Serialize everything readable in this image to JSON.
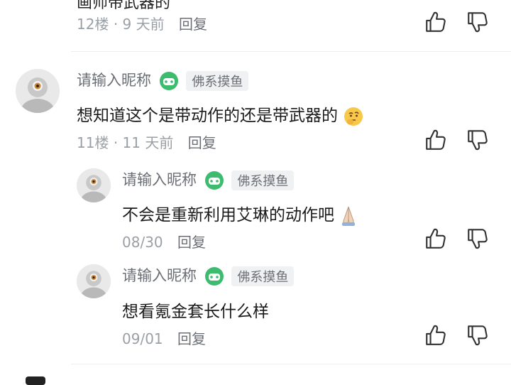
{
  "top_partial": {
    "content": "画师带武器的",
    "floor": "12楼",
    "time": "9 天前",
    "reply_label": "回复"
  },
  "comment_11": {
    "username": "请输入昵称",
    "badge": "佛系摸鱼",
    "content": "想知道这个是带动作的还是带武器的",
    "emoji": "thinking-face",
    "floor": "11楼",
    "time": "11 天前",
    "reply_label": "回复"
  },
  "reply_1": {
    "username": "请输入昵称",
    "badge": "佛系摸鱼",
    "content": "不会是重新利用艾琳的动作吧",
    "emoji": "praying-hands",
    "date": "08/30",
    "reply_label": "回复"
  },
  "reply_2": {
    "username": "请输入昵称",
    "badge": "佛系摸鱼",
    "content": "想看氪金套长什么样",
    "date": "09/01",
    "reply_label": "回复"
  },
  "icons": {
    "like": "thumbs-up-icon",
    "dislike": "thumbs-down-icon",
    "level": "game-controller-badge-icon"
  },
  "colors": {
    "badge_green": "#3dbb6e",
    "meta_gray": "#9aa0a6"
  }
}
